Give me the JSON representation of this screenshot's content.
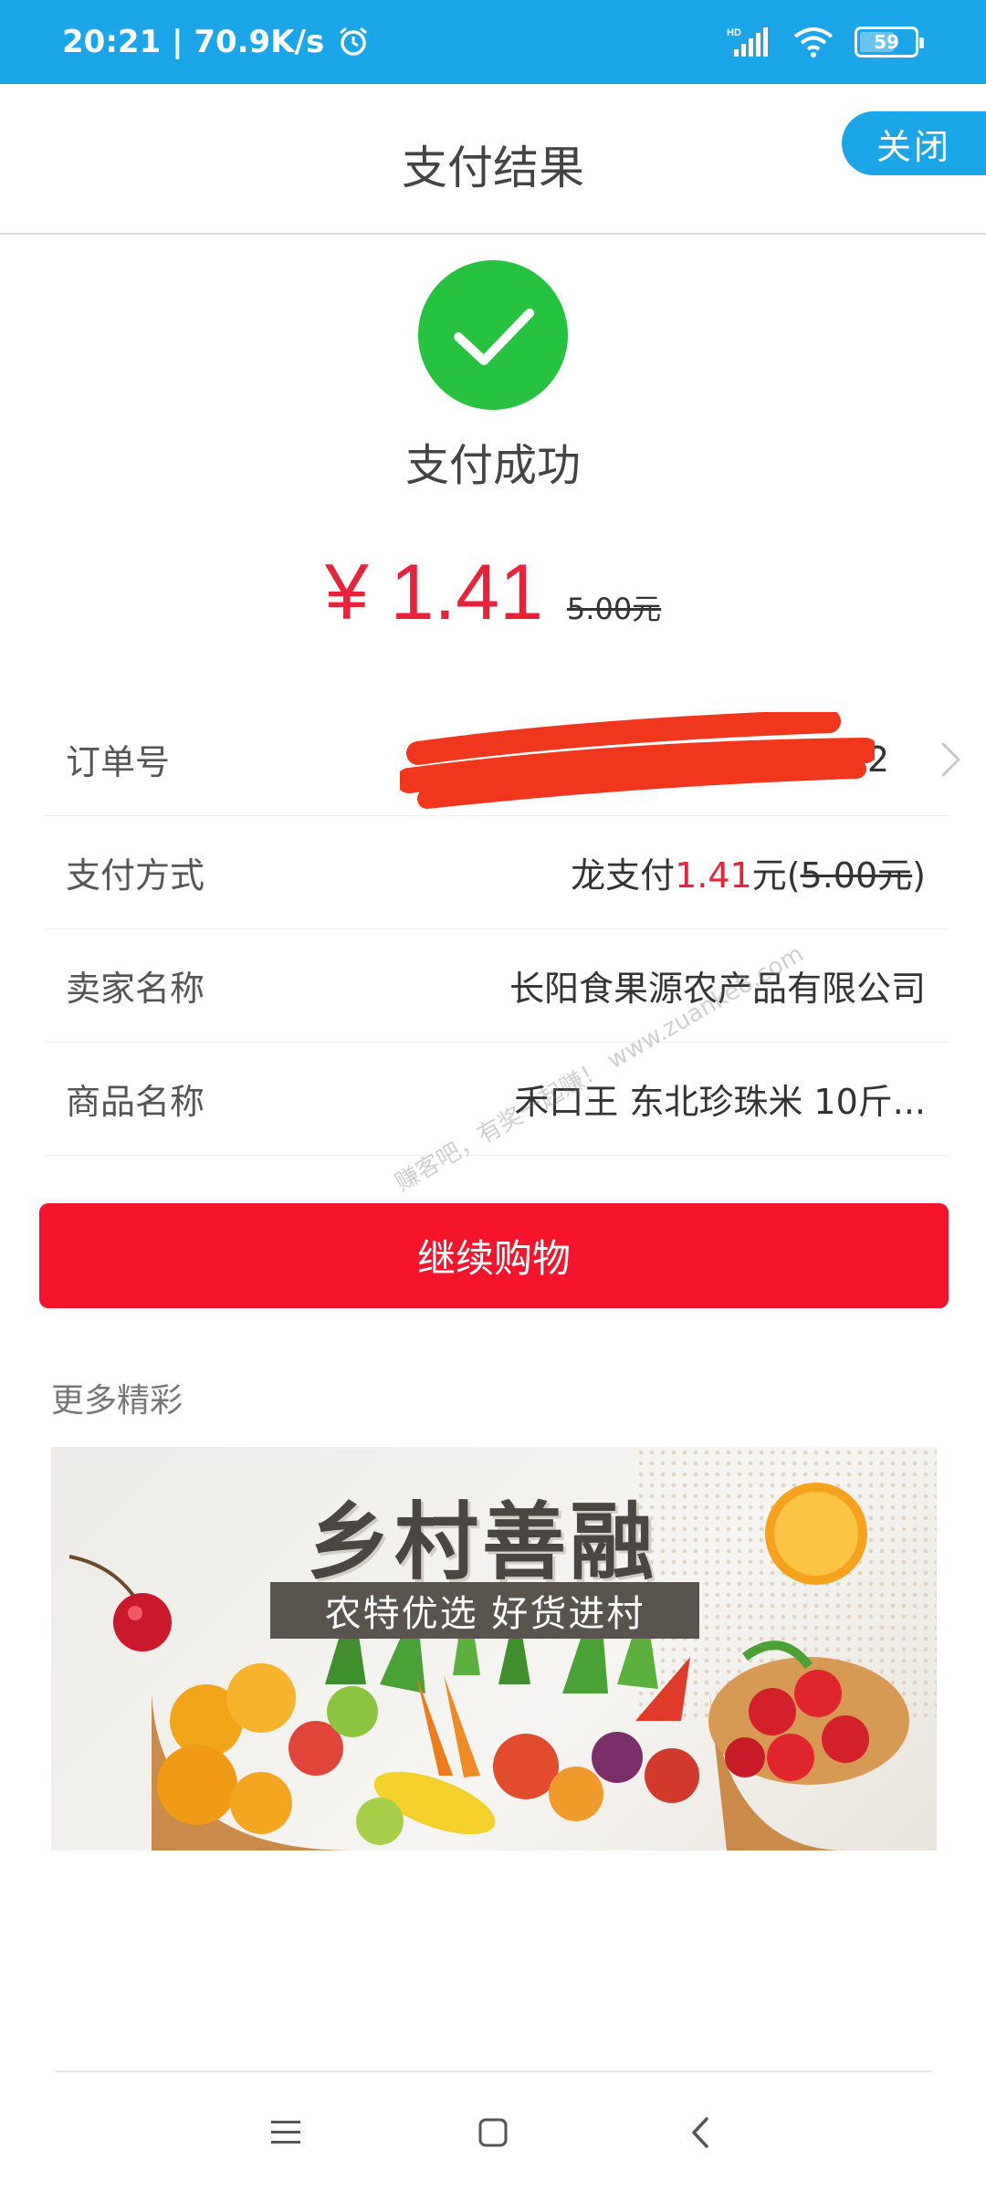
{
  "status_bar": {
    "time_speed": "20:21 | 70.9K/s",
    "battery": "59",
    "network": "HD",
    "icons": [
      "alarm-icon",
      "signal-icon",
      "wifi-icon",
      "battery-icon"
    ]
  },
  "header": {
    "title": "支付结果",
    "close_label": "关闭"
  },
  "result": {
    "status_text": "支付成功",
    "amount": "¥ 1.41",
    "original_amount": "5.00元"
  },
  "info": {
    "order_label": "订单号",
    "order_value": "202",
    "payment_label": "支付方式",
    "payment_prefix": "龙支付",
    "payment_amount": "1.41",
    "payment_unit": "元(",
    "payment_original": "5.00元",
    "payment_suffix": ")",
    "seller_label": "卖家名称",
    "seller_value": "长阳食果源农产品有限公司",
    "product_label": "商品名称",
    "product_value": "禾口王 东北珍珠米 10斤..."
  },
  "actions": {
    "continue_label": "继续购物"
  },
  "more": {
    "label": "更多精彩",
    "banner_title": "乡村善融",
    "banner_subtitle": "农特优选 好货进村"
  },
  "watermark": "赚客吧，有奖一起赚！ www.zuanke8.com",
  "colors": {
    "accent": "#1aa6e8",
    "success": "#25c33f",
    "price_red": "#e8223a",
    "button_red": "#f4142c"
  }
}
